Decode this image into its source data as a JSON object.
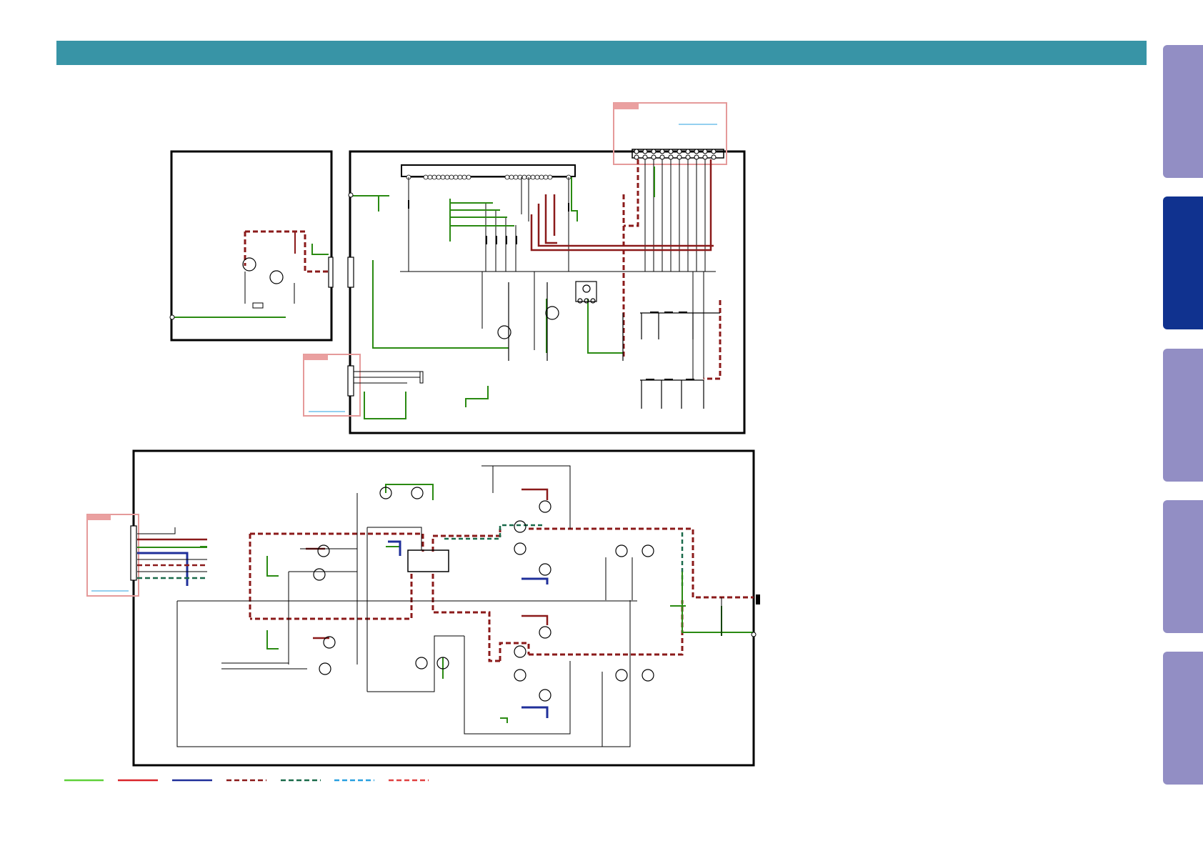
{
  "header": {
    "title": "",
    "color": "#3894a6"
  },
  "side_tabs": [
    {
      "label": "",
      "active": false,
      "color": "#928ec4"
    },
    {
      "label": "",
      "active": true,
      "color": "#10328f"
    },
    {
      "label": "",
      "active": false,
      "color": "#928ec4"
    },
    {
      "label": "",
      "active": false,
      "color": "#928ec4"
    },
    {
      "label": "",
      "active": false,
      "color": "#928ec4"
    }
  ],
  "legend": {
    "items": [
      {
        "name": "",
        "color": "#5fd03a",
        "style": "solid"
      },
      {
        "name": "",
        "color": "#d9252b",
        "style": "solid"
      },
      {
        "name": "",
        "color": "#1f2f9a",
        "style": "solid"
      },
      {
        "name": "",
        "color": "#8b1a1a",
        "style": "dashed"
      },
      {
        "name": "",
        "color": "#1a6a4a",
        "style": "dashed"
      },
      {
        "name": "",
        "color": "#28a0e0",
        "style": "dashed"
      },
      {
        "name": "",
        "color": "#e04040",
        "style": "dashed"
      }
    ]
  },
  "boards": [
    {
      "name": "",
      "connectors": []
    },
    {
      "name": "",
      "connectors": []
    },
    {
      "name": "",
      "connectors": []
    }
  ],
  "colors": {
    "board_outline": "#000000",
    "connector_box": "#e59a9a",
    "wire": "#000000",
    "link_line": "#28a0e0"
  }
}
